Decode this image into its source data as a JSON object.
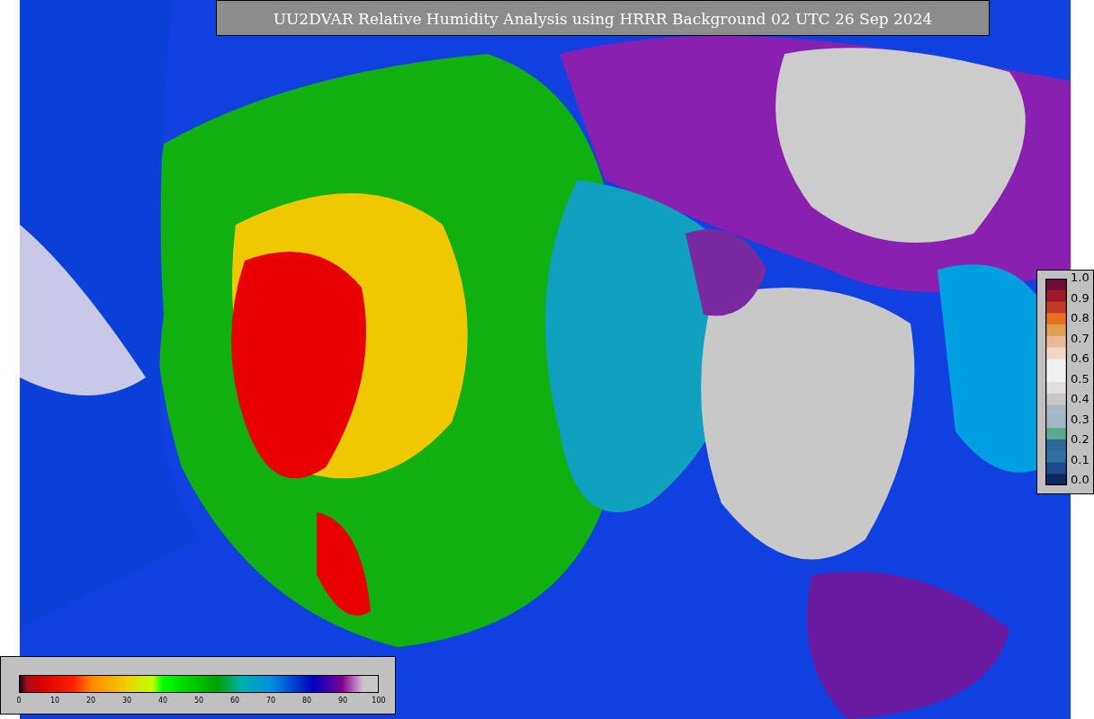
{
  "title": "UU2DVAR Relative Humidity Analysis using HRRR Background 02 UTC 26 Sep 2024",
  "bottom_colorbar": {
    "ticks": [
      "0",
      "10",
      "20",
      "30",
      "40",
      "50",
      "60",
      "70",
      "80",
      "90",
      "100"
    ]
  },
  "side_colorbar": {
    "ticks": [
      "1.0",
      "0.9",
      "0.8",
      "0.7",
      "0.6",
      "0.5",
      "0.4",
      "0.3",
      "0.2",
      "0.1",
      "0.0"
    ]
  }
}
